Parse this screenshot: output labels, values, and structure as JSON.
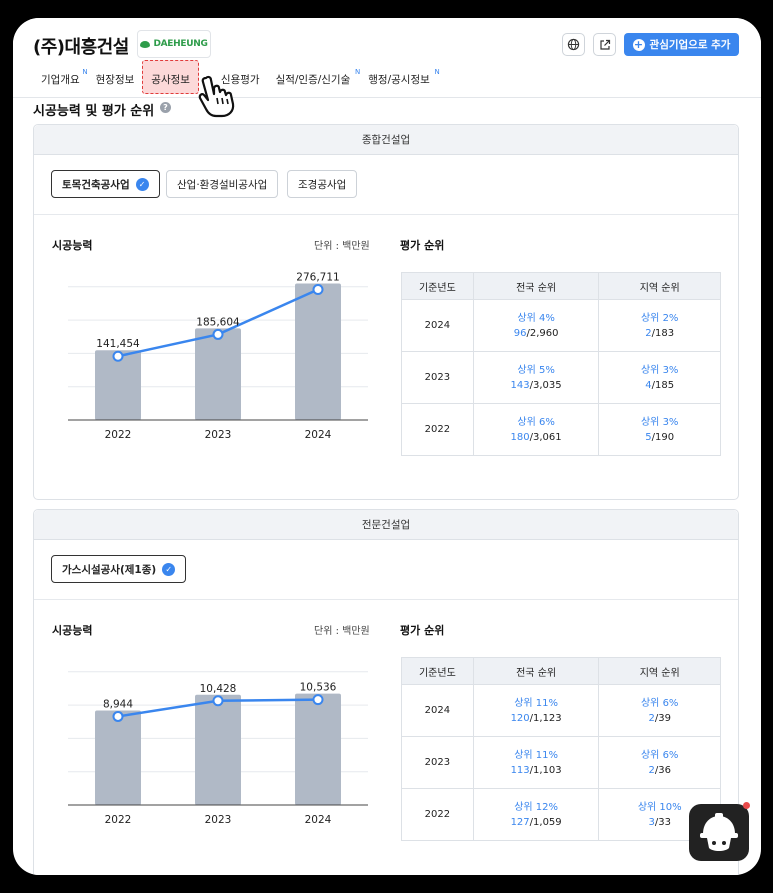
{
  "header": {
    "company_name": "(주)대흥건설",
    "logo_text": "DAEHEUNG",
    "add_button_label": "관심기업으로 추가",
    "globe_icon": "globe-icon",
    "external_icon": "external-link-icon"
  },
  "nav": {
    "items": [
      {
        "label": "기업개요",
        "new": "N"
      },
      {
        "label": "현장정보",
        "new": ""
      },
      {
        "label": "공사정보",
        "new": ""
      },
      {
        "label": "신용평가",
        "new": ""
      },
      {
        "label": "실적/인증/신기술",
        "new": "N"
      },
      {
        "label": "행정/공시정보",
        "new": "N"
      }
    ]
  },
  "section": {
    "title": "시공능력 및 평가 순위",
    "help": "?"
  },
  "general": {
    "head": "종합건설업",
    "chips": [
      "토목건축공사업",
      "산업·환경설비공사업",
      "조경공사업"
    ],
    "capacity_title": "시공능력",
    "unit": "단위 : 백만원",
    "rank_title": "평가 순위",
    "table": {
      "headers": [
        "기준년도",
        "전국 순위",
        "지역 순위"
      ],
      "rows": [
        {
          "year": "2024",
          "nat_pct": "상위 4%",
          "nat_rank": "96",
          "nat_total": "/2,960",
          "reg_pct": "상위 2%",
          "reg_rank": "2",
          "reg_total": "/183"
        },
        {
          "year": "2023",
          "nat_pct": "상위 5%",
          "nat_rank": "143",
          "nat_total": "/3,035",
          "reg_pct": "상위 3%",
          "reg_rank": "4",
          "reg_total": "/185"
        },
        {
          "year": "2022",
          "nat_pct": "상위 6%",
          "nat_rank": "180",
          "nat_total": "/3,061",
          "reg_pct": "상위 3%",
          "reg_rank": "5",
          "reg_total": "/190"
        }
      ]
    }
  },
  "special": {
    "head": "전문건설업",
    "chips": [
      "가스시설공사(제1종)"
    ],
    "capacity_title": "시공능력",
    "unit": "단위 : 백만원",
    "rank_title": "평가 순위",
    "table": {
      "headers": [
        "기준년도",
        "전국 순위",
        "지역 순위"
      ],
      "rows": [
        {
          "year": "2024",
          "nat_pct": "상위 11%",
          "nat_rank": "120",
          "nat_total": "/1,123",
          "reg_pct": "상위 6%",
          "reg_rank": "2",
          "reg_total": "/39"
        },
        {
          "year": "2023",
          "nat_pct": "상위 11%",
          "nat_rank": "113",
          "nat_total": "/1,103",
          "reg_pct": "상위 6%",
          "reg_rank": "2",
          "reg_total": "/36"
        },
        {
          "year": "2022",
          "nat_pct": "상위 12%",
          "nat_rank": "127",
          "nat_total": "/1,059",
          "reg_pct": "상위 10%",
          "reg_rank": "3",
          "reg_total": "/33"
        }
      ]
    }
  },
  "chart_data": [
    {
      "type": "bar",
      "categories": [
        "2022",
        "2023",
        "2024"
      ],
      "values": [
        141454,
        185604,
        276711
      ],
      "labels": [
        "141,454",
        "185,604",
        "276,711"
      ],
      "overlay_line": true,
      "ylim": [
        0,
        300000
      ],
      "grid": true,
      "bar_color": "#b0b9c6",
      "line_color": "#3a86ee"
    },
    {
      "type": "bar",
      "categories": [
        "2022",
        "2023",
        "2024"
      ],
      "values": [
        8944,
        10428,
        10536
      ],
      "labels": [
        "8,944",
        "10,428",
        "10,536"
      ],
      "overlay_line": true,
      "ylim": [
        0,
        14000
      ],
      "grid": true,
      "bar_color": "#b0b9c6",
      "line_color": "#3a86ee"
    }
  ]
}
